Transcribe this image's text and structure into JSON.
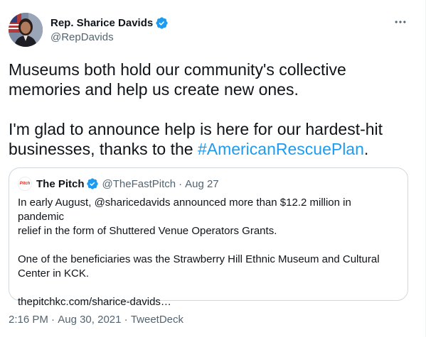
{
  "author": {
    "name": "Rep. Sharice Davids",
    "handle": "@RepDavids"
  },
  "tweet": {
    "text_part1": "Museums both hold our community's collective\nmemories and help us create new ones.\n\nI'm glad to announce help is here for our hardest-hit\nbusinesses, thanks to the ",
    "hashtag": "#AmericanRescuePlan",
    "text_part2": "."
  },
  "quoted": {
    "avatar_text": "Pitch",
    "name": "The Pitch",
    "handle": "@TheFastPitch",
    "separator": "·",
    "date": "Aug 27",
    "text": "In early August, @sharicedavids announced more than $12.2 million in pandemic\nrelief in the form of Shuttered Venue Operators Grants.\n\nOne of the beneficiaries was the Strawberry Hill Ethnic Museum and Cultural\nCenter in KCK.\n\nthepitchkc.com/sharice-davids…"
  },
  "meta": {
    "time": "2:16 PM",
    "separator": " · ",
    "date": "Aug 30, 2021",
    "source": "TweetDeck"
  },
  "colors": {
    "accent": "#1d9bf0",
    "secondary_text": "#536471",
    "border": "#cfd9de"
  },
  "icons": {
    "verified": "verified-badge-icon",
    "more": "more-options-icon"
  }
}
